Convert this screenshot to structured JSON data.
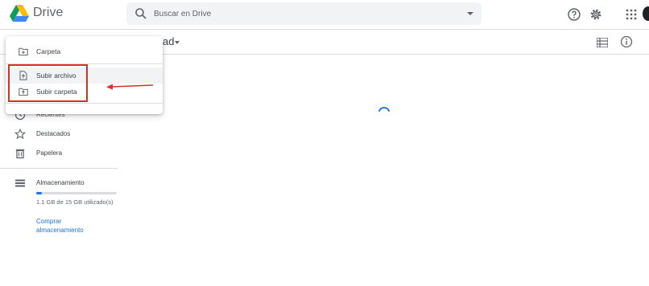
{
  "header": {
    "app_name": "Drive",
    "search": {
      "placeholder": "Buscar en Drive"
    },
    "icons": [
      "drive-logo",
      "search-icon",
      "help-icon",
      "gear-icon",
      "apps-icon"
    ]
  },
  "toolbar": {
    "title_fragment": "ad"
  },
  "new_menu": {
    "items": [
      {
        "label": "Carpeta",
        "icon": "new-folder-icon"
      },
      {
        "label": "Subir archivo",
        "icon": "file-upload-icon"
      },
      {
        "label": "Subir carpeta",
        "icon": "folder-upload-icon"
      }
    ]
  },
  "sidebar": {
    "items": [
      {
        "label": "Recientes",
        "icon": "clock-icon"
      },
      {
        "label": "Destacados",
        "icon": "star-icon"
      },
      {
        "label": "Papelera",
        "icon": "trash-icon"
      }
    ],
    "storage": {
      "label": "Almacenamiento",
      "usage_text": "1.1 GB de 15 GB utilizado(s)",
      "used_fraction": 0.073,
      "buy_label": "Comprar almacenamiento"
    }
  },
  "colors": {
    "accent": "#1a73e8",
    "annotation": "#d93025",
    "menu_hover": "#f1f3f4"
  }
}
